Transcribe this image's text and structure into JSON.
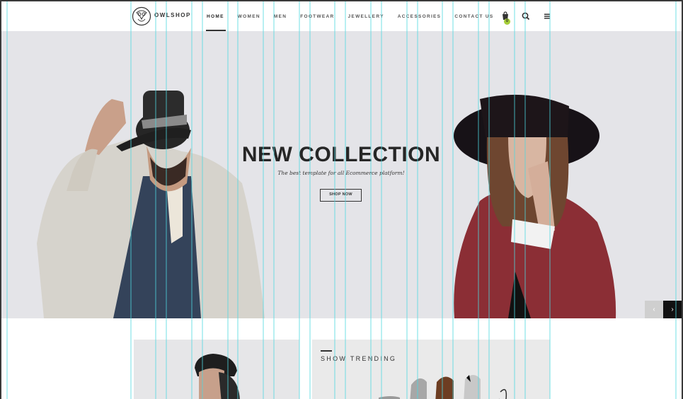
{
  "header": {
    "logo_text": "OWLSHOP",
    "nav": [
      "HOME",
      "WOMEN",
      "MEN",
      "FOOTWEAR",
      "JEWELLERY",
      "ACCESSORIES",
      "CONTACT US"
    ],
    "active_nav": "HOME",
    "cart_count": "0",
    "icons": [
      "cart-icon",
      "search-icon",
      "menu-icon"
    ]
  },
  "hero": {
    "title": "NEW COLLECTION",
    "subtitle": "The best template for all Ecommerce platform!",
    "cta": "SHOP NOW",
    "prev": "‹",
    "next": "›"
  },
  "trending": {
    "label": "SHOW TRENDING"
  },
  "colors": {
    "accent": "#a6ce39",
    "guide": "#4fd8e0",
    "hero_bg": "#e4e4e8"
  }
}
